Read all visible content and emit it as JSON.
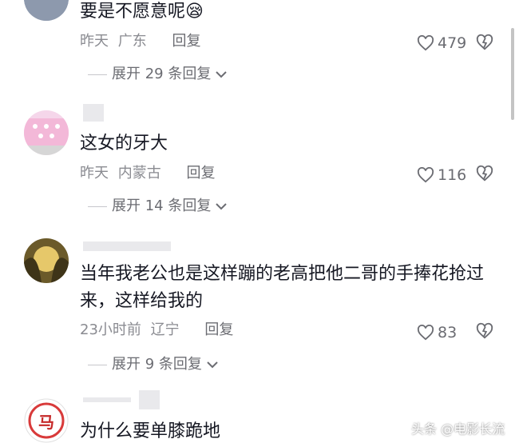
{
  "comments": [
    {
      "text": "要是不愿意呢😪",
      "time": "昨天",
      "location": "广东",
      "reply": "回复",
      "likes": "479",
      "expand": "展开 29 条回复"
    },
    {
      "text": "这女的牙大",
      "time": "昨天",
      "location": "内蒙古",
      "reply": "回复",
      "likes": "116",
      "expand": "展开 14 条回复"
    },
    {
      "text": "当年我老公也是这样蹦的老高把他二哥的手捧花抢过来，这样给我的",
      "time": "23小时前",
      "location": "辽宁",
      "reply": "回复",
      "likes": "83",
      "expand": "展开 9 条回复"
    },
    {
      "text": "为什么要单膝跪地",
      "avatar_text": "马"
    }
  ],
  "watermark": "头条 @电影长流",
  "colors": {
    "text": "#161823",
    "meta": "#8a8b91",
    "icon": "#6b6c72"
  }
}
